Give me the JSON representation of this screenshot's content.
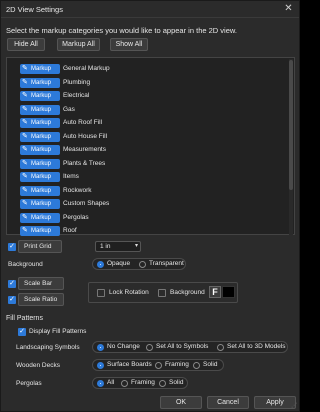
{
  "window": {
    "title": "2D View Settings",
    "close_glyph": "✕"
  },
  "instruction": "Select the markup categories you would like to appear in the 2D view.",
  "top_buttons": {
    "hide_all": "Hide All",
    "markup_all": "Markup All",
    "show_all": "Show All"
  },
  "markup_pill_label": "Markup",
  "categories": [
    "General Markup",
    "Plumbing",
    "Electrical",
    "Gas",
    "Auto Roof Fill",
    "Auto House Fill",
    "Measurements",
    "Plants & Trees",
    "Items",
    "Rockwork",
    "Custom Shapes",
    "Pergolas",
    "Roof"
  ],
  "print_grid": {
    "label": "Print Grid",
    "checked": true,
    "value": "1 in"
  },
  "background": {
    "label": "Background",
    "options": [
      "Opaque",
      "Transparent"
    ],
    "selected": "Opaque"
  },
  "scale_bar": {
    "label": "Scale Bar",
    "checked": true
  },
  "scale_ratio": {
    "label": "Scale Ratio",
    "checked": true
  },
  "scale_options": {
    "lock_rotation": "Lock Rotation",
    "background": "Background",
    "font_button": "F"
  },
  "fill_patterns": {
    "section": "Fill Patterns",
    "display_label": "Display Fill Patterns",
    "display_checked": true,
    "landscaping": {
      "label": "Landscaping Symbols",
      "options": [
        "No Change",
        "Set All to Symbols",
        "Set All to 3D Models"
      ],
      "selected": "No Change"
    },
    "wooden_decks": {
      "label": "Wooden Decks",
      "options": [
        "Surface Boards",
        "Framing",
        "Solid"
      ],
      "selected": "Surface Boards"
    },
    "pergolas": {
      "label": "Pergolas",
      "options": [
        "All",
        "Framing",
        "Solid"
      ],
      "selected": "All"
    }
  },
  "dialog_buttons": {
    "ok": "OK",
    "cancel": "Cancel",
    "apply": "Apply"
  },
  "colors": {
    "accent": "#2d7ad9",
    "panel": "#2b2b2b",
    "list_bg": "#222222"
  }
}
